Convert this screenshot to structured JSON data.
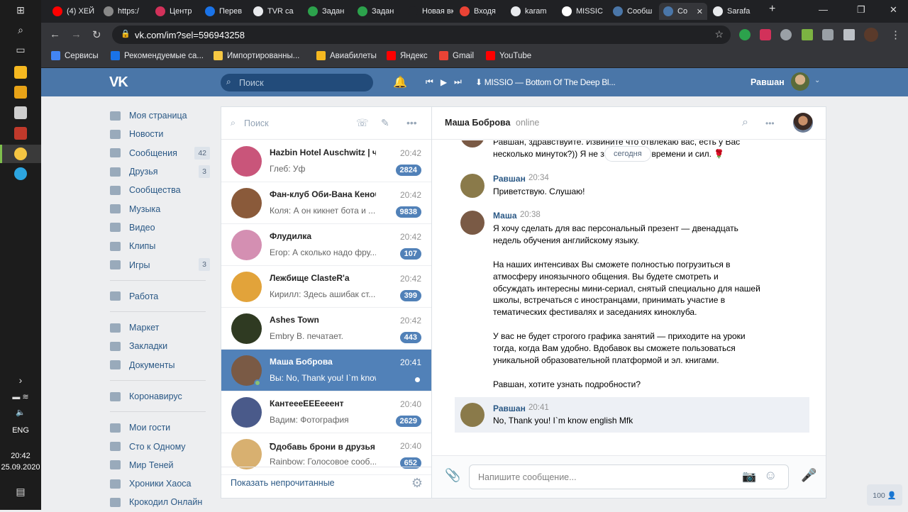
{
  "taskbar": {
    "lang": "ENG",
    "time": "20:42",
    "date": "25.09.2020"
  },
  "browser": {
    "tabs": [
      {
        "label": "(4) ХЕЙ",
        "color": "#ff0000"
      },
      {
        "label": "https:/",
        "color": "#888888"
      },
      {
        "label": "Центр",
        "color": "#d2315a"
      },
      {
        "label": "Перев",
        "color": "#1a73e8"
      },
      {
        "label": "TVR са",
        "color": "#e8eaed"
      },
      {
        "label": "Задан",
        "color": "#2ca24c"
      },
      {
        "label": "Задан",
        "color": "#2ca24c"
      },
      {
        "label": "Новая вкла",
        "color": "#202124"
      },
      {
        "label": "Входя",
        "color": "#ea4335"
      },
      {
        "label": "karam",
        "color": "#e8eaed"
      },
      {
        "label": "MISSIC",
        "color": "#ffffff"
      },
      {
        "label": "Сообш",
        "color": "#4a76a8"
      },
      {
        "label": "Co",
        "color": "#4a76a8"
      },
      {
        "label": "Sarafa",
        "color": "#e8eaed"
      }
    ],
    "new_tab": "+",
    "url": "vk.com/im?sel=596943258",
    "bookmarks": [
      {
        "label": "Сервисы",
        "color": "#4285f4"
      },
      {
        "label": "Рекомендуемые са...",
        "color": "#1a73e8"
      },
      {
        "label": "Импортированны...",
        "color": "#f7c843"
      },
      {
        "label": "Авиабилеты",
        "color": "#f5b820"
      },
      {
        "label": "Яндекс",
        "color": "#ff0000"
      },
      {
        "label": "Gmail",
        "color": "#ea4335"
      },
      {
        "label": "YouTube",
        "color": "#ff0000"
      }
    ]
  },
  "vk_header": {
    "logo": "VK",
    "search_placeholder": "Поиск",
    "track": "⬇ MISSIO — Bottom Of The Deep Bl...",
    "user_name": "Равшан"
  },
  "left_nav": {
    "group1": [
      {
        "label": "Моя страница",
        "count": ""
      },
      {
        "label": "Новости",
        "count": ""
      },
      {
        "label": "Сообщения",
        "count": "42"
      },
      {
        "label": "Друзья",
        "count": "3"
      },
      {
        "label": "Сообщества",
        "count": ""
      },
      {
        "label": "Музыка",
        "count": ""
      },
      {
        "label": "Видео",
        "count": ""
      },
      {
        "label": "Клипы",
        "count": ""
      },
      {
        "label": "Игры",
        "count": "3"
      }
    ],
    "group2": [
      {
        "label": "Работа",
        "count": ""
      }
    ],
    "group3": [
      {
        "label": "Маркет",
        "count": ""
      },
      {
        "label": "Закладки",
        "count": ""
      },
      {
        "label": "Документы",
        "count": ""
      }
    ],
    "group4": [
      {
        "label": "Коронавирус",
        "count": ""
      }
    ],
    "group5": [
      {
        "label": "Мои гости",
        "count": ""
      },
      {
        "label": "Сто к Одному",
        "count": ""
      },
      {
        "label": "Мир Теней",
        "count": ""
      },
      {
        "label": "Хроники Хаоса",
        "count": ""
      },
      {
        "label": "Крокодил Онлайн",
        "count": ""
      }
    ]
  },
  "dialogs": {
    "search_placeholder": "Поиск",
    "footer": "Показать непрочитанные",
    "items": [
      {
        "name": "Hazbin Hotel Auschwitz | ч...",
        "time": "20:42",
        "preview": "Глеб: Уф",
        "badge": "2824",
        "selected": false,
        "avatar": "#c9557a"
      },
      {
        "name": "Фан-клуб Оби-Вана Кеноби",
        "time": "20:42",
        "preview": "Коля: А он кикнет бота и ...",
        "badge": "9838",
        "selected": false,
        "avatar": "#8a5a3a"
      },
      {
        "name": "Флудилка",
        "time": "20:42",
        "preview": "Егор: А сколько надо фру...",
        "badge": "107",
        "selected": false,
        "avatar": "#d48fb2"
      },
      {
        "name": "Лежбище ClasteR'a",
        "time": "20:42",
        "preview": "Кирилл: Здесь ашибак ст...",
        "badge": "399",
        "selected": false,
        "avatar": "#e2a33a"
      },
      {
        "name": "Ashes Town",
        "time": "20:42",
        "preview": "Embry B. печатает.",
        "badge": "443",
        "selected": false,
        "avatar": "#2f3a22"
      },
      {
        "name": "Маша Боброва",
        "time": "20:41",
        "preview": "Вы: No, Thank you! I`m know english...",
        "badge": "",
        "selected": true,
        "avatar": "#7a5a45"
      },
      {
        "name": "КантеееЕЕЕееент",
        "time": "20:40",
        "preview": "Вадим: Фотография",
        "badge": "2629",
        "selected": false,
        "avatar": "#4a5a8a"
      },
      {
        "name": "Ꝺдобавь брони в друзья ...",
        "time": "20:40",
        "preview": "Rainbow: Голосовое сооб...",
        "badge": "652",
        "selected": false,
        "avatar": "#d8b070"
      }
    ]
  },
  "chat": {
    "name": "Маша Боброва",
    "status": "online",
    "date_pill": "сегодня",
    "messages": [
      {
        "author": "",
        "time": "",
        "text": "Равшан, здравствуйте. Извините что отвлекаю вас, есть у Вас\nнесколько минуток?)) Я не займу много времени и сил. 🌹"
      },
      {
        "author": "Равшан",
        "time": "20:34",
        "text": "Приветствую. Слушаю!"
      },
      {
        "author": "Маша",
        "time": "20:38",
        "text": "Я хочу сделать для вас персональный презент — двенадцать\nнедель обучения английскому языку.\n\nНа наших интенсивах Вы сможете полностью погрузиться в\nатмосферу иноязычного общения. Вы будете смотреть и\nобсуждать интересны мини-сериал, снятый специально для нашей\nшколы, встречаться с иностранцами, принимать участие в\nтематических фестивалях и заседаниях киноклуба.\n\nУ вас не будет строгого графика занятий — приходите на уроки\nтогда, когда Вам удобно. Вдобавок вы сможете пользоваться\nуникальной образовательной платформой и эл. книгами.\n\nРавшан, хотите узнать подробности?"
      },
      {
        "author": "Равшан",
        "time": "20:41",
        "text": "No, Thank you! I`m know english Mfk"
      }
    ],
    "composer_placeholder": "Напишите сообщение..."
  },
  "online_count": "100 👤",
  "colors": {
    "vk_blue": "#4a76a8",
    "selected_dialog": "#5181b8",
    "link": "#2a5885"
  }
}
